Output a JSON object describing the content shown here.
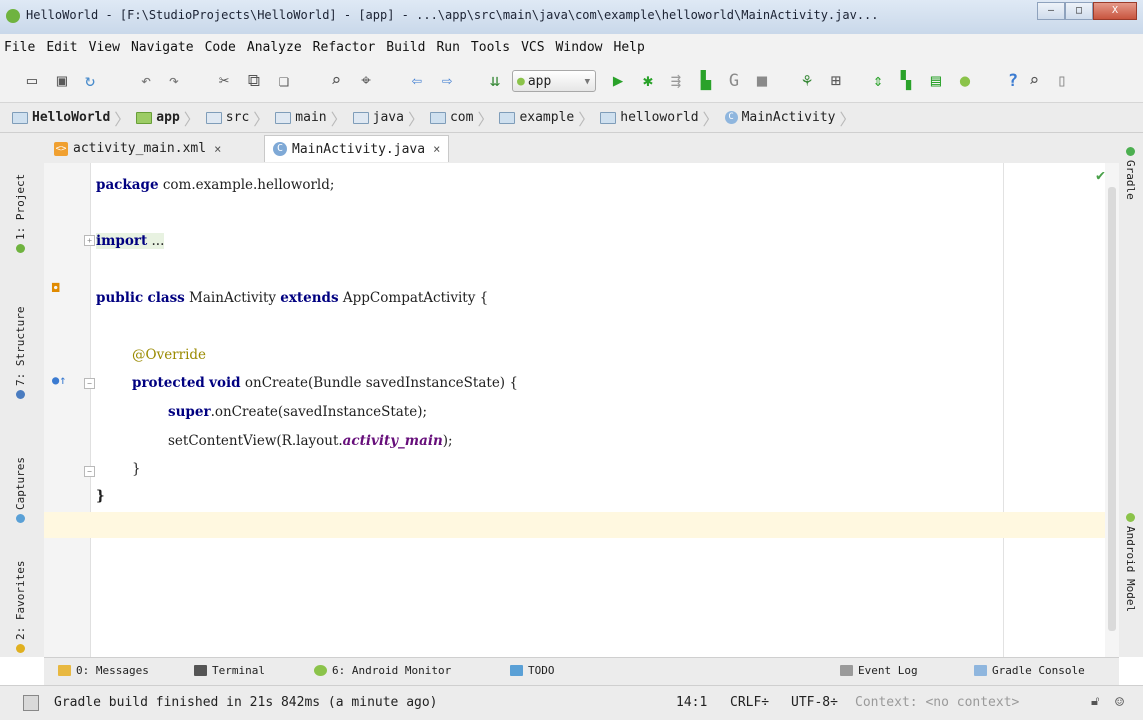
{
  "window": {
    "title": "HelloWorld - [F:\\StudioProjects\\HelloWorld] - [app] - ...\\app\\src\\main\\java\\com\\example\\helloworld\\MainActivity.jav...",
    "min_label": "–",
    "max_label": "□",
    "close_label": "X"
  },
  "menu": [
    "File",
    "Edit",
    "View",
    "Navigate",
    "Code",
    "Analyze",
    "Refactor",
    "Build",
    "Run",
    "Tools",
    "VCS",
    "Window",
    "Help"
  ],
  "toolbar": {
    "run_config": "app",
    "help_label": "?"
  },
  "breadcrumb": [
    "HelloWorld",
    "app",
    "src",
    "main",
    "java",
    "com",
    "example",
    "helloworld",
    "MainActivity"
  ],
  "left_tool_tabs": [
    "1: Project",
    "7: Structure",
    "Captures",
    "2: Favorites"
  ],
  "right_tool_tabs": [
    "Gradle",
    "Android Model"
  ],
  "editor_tabs": [
    {
      "label": "activity_main.xml",
      "close": "×",
      "active": false
    },
    {
      "label": "MainActivity.java",
      "close": "×",
      "active": true
    }
  ],
  "code": {
    "l1_kw": "package",
    "l1_rest": " com.example.helloworld;",
    "l2_kw": "import",
    "l2_rest": " ...",
    "l3_kw1": "public",
    "l3_kw2": "class",
    "l3_name": " MainActivity ",
    "l3_kw3": "extends",
    "l3_rest": " AppCompatActivity {",
    "l4": "@Override",
    "l5_kw1": "protected",
    "l5_kw2": "void",
    "l5_rest": " onCreate(Bundle savedInstanceState) {",
    "l6_kw": "super",
    "l6_rest": ".onCreate(savedInstanceState);",
    "l7_a": "setContentView(R.layout.",
    "l7_field": "activity_main",
    "l7_b": ");",
    "l8": "}",
    "l9": "}"
  },
  "bottom_tools": [
    {
      "label": "0: Messages"
    },
    {
      "label": "Terminal"
    },
    {
      "label": "6: Android Monitor"
    },
    {
      "label": "TODO"
    },
    {
      "label": "Event Log"
    },
    {
      "label": "Gradle Console"
    }
  ],
  "status": {
    "message": "Gradle build finished in 21s 842ms (a minute ago)",
    "position": "14:1",
    "line_sep": "CRLF÷",
    "encoding": "UTF-8÷",
    "context": "Context: <no context>"
  },
  "colors": {
    "keyword": "#000080",
    "annotation": "#9a8a00",
    "field": "#660e7a",
    "android_green": "#8bc34a",
    "run_green": "#2aa22a"
  }
}
